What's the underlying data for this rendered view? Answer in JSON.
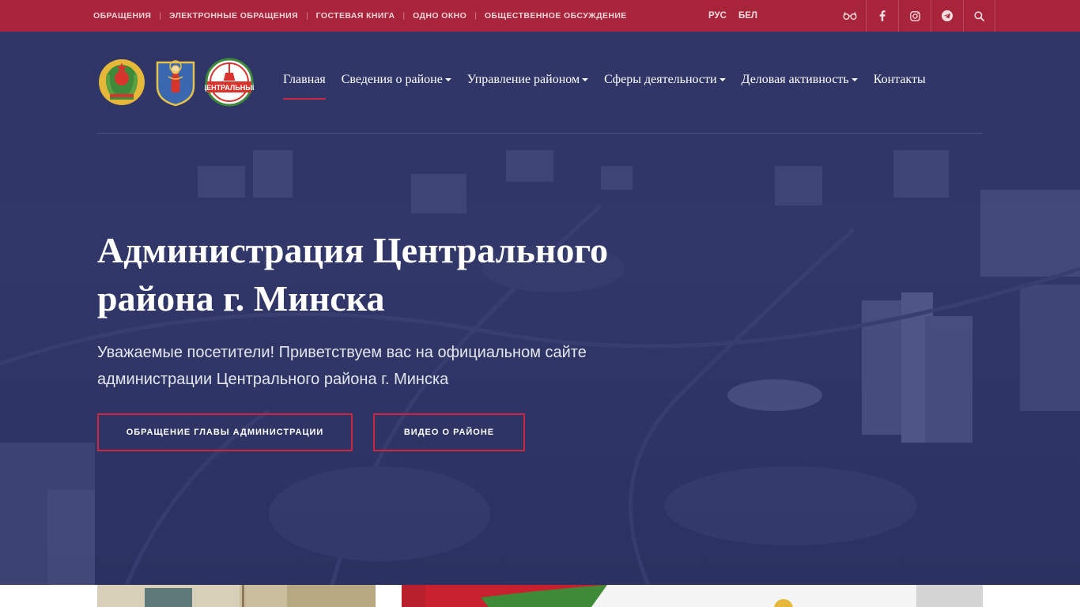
{
  "topbar": {
    "links": [
      "ОБРАЩЕНИЯ",
      "ЭЛЕКТРОННЫЕ ОБРАЩЕНИЯ",
      "ГОСТЕВАЯ КНИГА",
      "ОДНО ОКНО",
      "ОБЩЕСТВЕННОЕ ОБСУЖДЕНИЕ"
    ],
    "separator": "|",
    "languages": [
      "РУС",
      "БЕЛ"
    ],
    "icons": [
      "glasses-icon",
      "facebook-icon",
      "instagram-icon",
      "telegram-icon",
      "search-icon"
    ],
    "color": "#a8243a"
  },
  "nav": {
    "items": [
      {
        "label": "Главная",
        "active": true,
        "dropdown": false
      },
      {
        "label": "Сведения о районе",
        "active": false,
        "dropdown": true
      },
      {
        "label": "Управление районом",
        "active": false,
        "dropdown": true
      },
      {
        "label": "Сферы деятельности",
        "active": false,
        "dropdown": true
      },
      {
        "label": "Деловая активность",
        "active": false,
        "dropdown": true
      },
      {
        "label": "Контакты",
        "active": false,
        "dropdown": false
      }
    ]
  },
  "logos": {
    "coat_of_arms_text": "",
    "district_logo_text": "ЦЕНТРАЛЬНЫЙ"
  },
  "hero": {
    "title": "Администрация Центрального района г. Минска",
    "subtitle": "Уважаемые посетители! Приветствуем вас на официальном сайте администрации Центрального района г. Минска",
    "button_primary": "ОБРАЩЕНИЕ ГЛАВЫ АДМИНИСТРАЦИИ",
    "button_secondary": "ВИДЕО О РАЙОНЕ"
  },
  "colors": {
    "accent": "#c8283f",
    "hero_overlay": "#2f3566"
  }
}
